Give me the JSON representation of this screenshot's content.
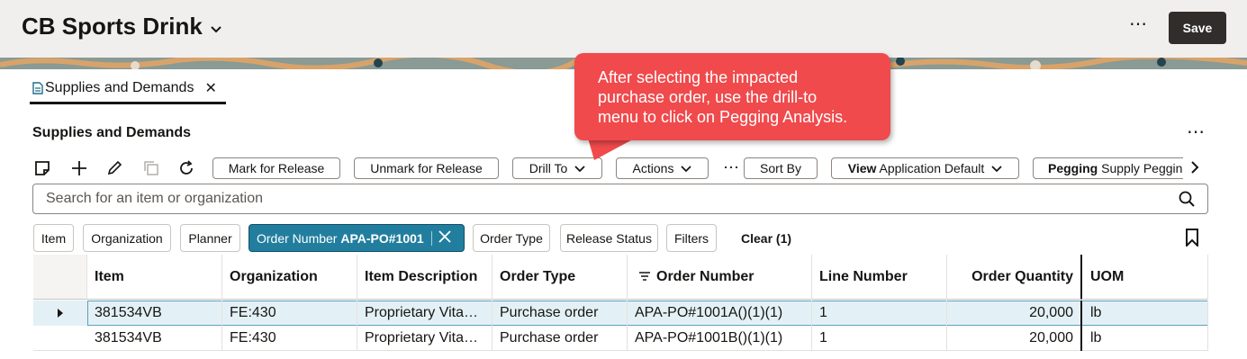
{
  "header": {
    "title": "CB Sports Drink",
    "more_label": "⋯",
    "save_label": "Save"
  },
  "tab": {
    "label": "Supplies and Demands",
    "close": "✕"
  },
  "section": {
    "title": "Supplies and Demands",
    "more_label": "⋯"
  },
  "toolbar": {
    "icons": [
      "note-icon",
      "add-icon",
      "edit-icon",
      "duplicate-icon",
      "refresh-icon"
    ],
    "mark_release": "Mark for Release",
    "unmark_release": "Unmark for Release",
    "drill_to": "Drill To",
    "actions": "Actions",
    "overflow": "⋯",
    "sort_by": "Sort By",
    "view_prefix": "View",
    "view_value": "Application Default",
    "pegging_prefix": "Pegging",
    "pegging_value": "Supply Pegging"
  },
  "search": {
    "placeholder": "Search for an item or organization"
  },
  "filters": {
    "chips": [
      "Item",
      "Organization",
      "Planner"
    ],
    "active_chip_label": "Order Number",
    "active_chip_value": "APA-PO#1001",
    "more_chips": [
      "Order Type",
      "Release Status",
      "Filters"
    ],
    "clear": "Clear (1)"
  },
  "table": {
    "columns": [
      "Item",
      "Organization",
      "Item Description",
      "Order Type",
      "Order Number",
      "Line Number",
      "Order Quantity",
      "UOM"
    ],
    "rows": [
      [
        "381534VB",
        "FE:430",
        "Proprietary Vita…",
        "Purchase order",
        "APA-PO#1001A()(1)(1)",
        "1",
        "20,000",
        "lb"
      ],
      [
        "381534VB",
        "FE:430",
        "Proprietary Vita…",
        "Purchase order",
        "APA-PO#1001B()(1)(1)",
        "1",
        "20,000",
        "lb"
      ]
    ]
  },
  "callout": {
    "line1": "After selecting the impacted",
    "line2": "purchase order, use the drill-to",
    "line3": "menu to click on Pegging Analysis."
  },
  "colors": {
    "accent": "#227e9e",
    "callout": "#f04a4c",
    "save": "#312d2a"
  }
}
